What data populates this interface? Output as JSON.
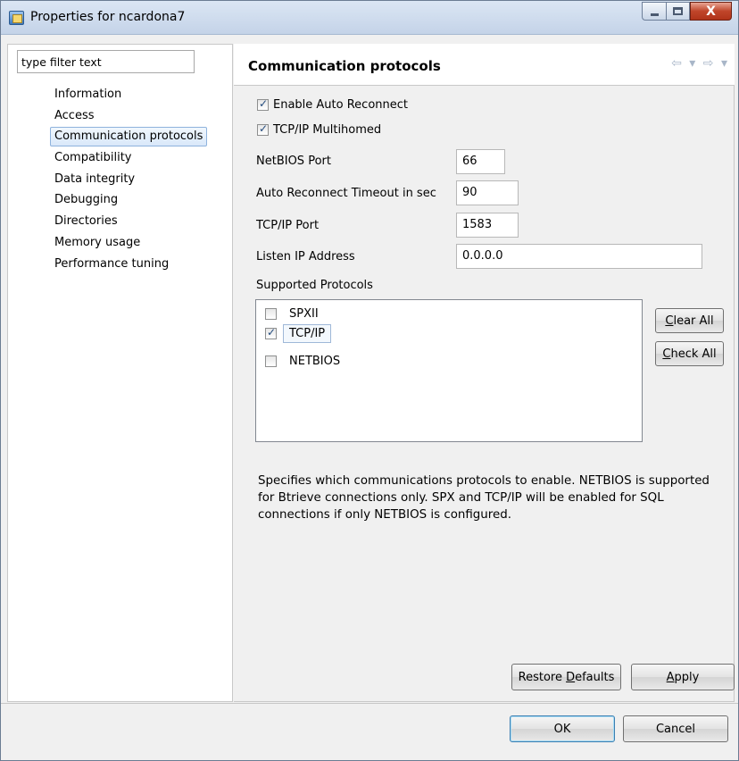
{
  "window": {
    "title": "Properties for ncardona7",
    "close_glyph": "X"
  },
  "filter": {
    "value": "type filter text"
  },
  "nav": {
    "items": [
      {
        "label": "Information"
      },
      {
        "label": "Access"
      },
      {
        "label": "Communication protocols",
        "selected": true
      },
      {
        "label": "Compatibility"
      },
      {
        "label": "Data integrity"
      },
      {
        "label": "Debugging"
      },
      {
        "label": "Directories"
      },
      {
        "label": "Memory usage"
      },
      {
        "label": "Performance tuning"
      }
    ]
  },
  "page": {
    "title": "Communication protocols",
    "back_arrow": "⇦ ▾",
    "forward_arrow": "⇨ ▾"
  },
  "options": {
    "enable_auto_reconnect": {
      "label": "Enable Auto Reconnect",
      "checked": true
    },
    "tcpip_multihomed": {
      "label": "TCP/IP Multihomed",
      "checked": true
    }
  },
  "fields": {
    "netbios_port": {
      "label": "NetBIOS Port",
      "value": "66"
    },
    "auto_reconnect_timeout": {
      "label": "Auto Reconnect Timeout in sec",
      "value": "90"
    },
    "tcpip_port": {
      "label": "TCP/IP Port",
      "value": "1583"
    },
    "listen_ip": {
      "label": "Listen IP Address",
      "value": "0.0.0.0"
    }
  },
  "protocols": {
    "label": "Supported Protocols",
    "items": [
      {
        "label": "SPXII",
        "checked": false
      },
      {
        "label": "TCP/IP",
        "checked": true
      },
      {
        "label": "NETBIOS",
        "checked": false
      }
    ],
    "clear_all_label": "lear All",
    "clear_all_mnemonic": "C",
    "check_all_label": "heck All",
    "check_all_mnemonic": "C"
  },
  "description": "Specifies which communications protocols to enable. NETBIOS is supported for Btrieve connections only. SPX and TCP/IP will be enabled for SQL connections if only NETBIOS is configured.",
  "buttons": {
    "restore_defaults_prefix": "Restore ",
    "restore_defaults_mnemonic": "D",
    "restore_defaults_suffix": "efaults",
    "apply_mnemonic": "A",
    "apply_suffix": "pply",
    "ok": "OK",
    "cancel": "Cancel"
  }
}
